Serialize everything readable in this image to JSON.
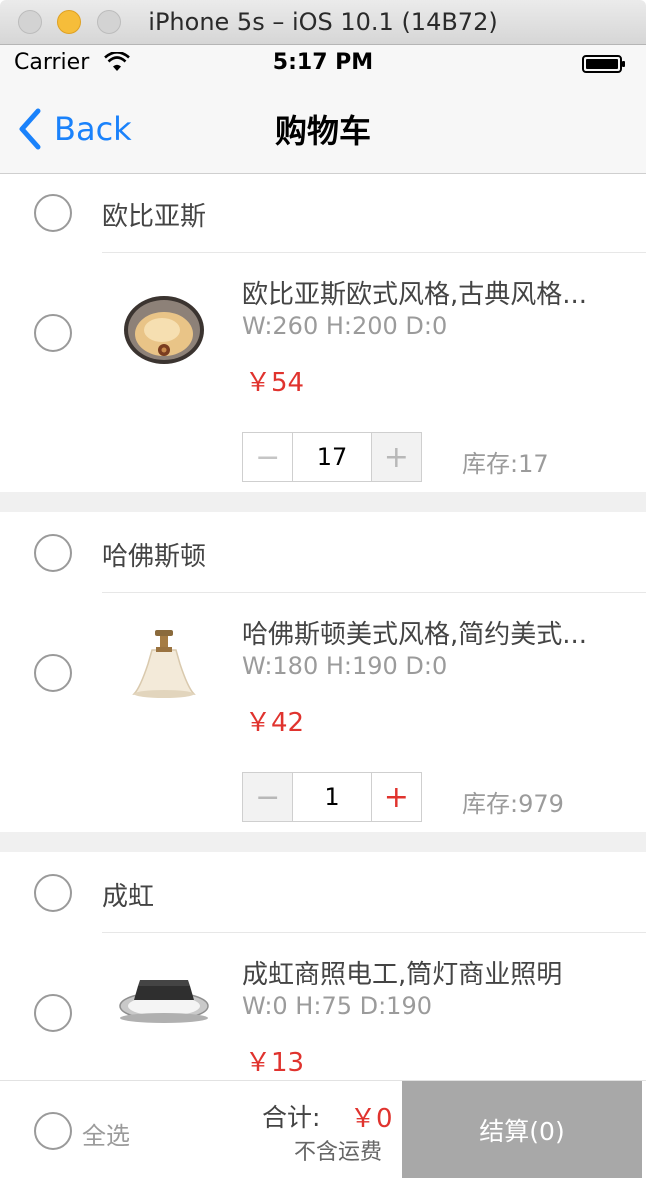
{
  "window": {
    "title": "iPhone 5s – iOS 10.1 (14B72)"
  },
  "status_bar": {
    "carrier": "Carrier",
    "time": "5:17 PM"
  },
  "nav": {
    "back_label": "Back",
    "title": "购物车"
  },
  "shops": [
    {
      "name": "欧比亚斯",
      "item": {
        "title": "欧比亚斯欧式风格,古典风格...",
        "spec": "W:260 H:200 D:0",
        "price": "￥54",
        "quantity": "17",
        "stock": "库存:17",
        "image_icon": "ceiling-lamp-ornate"
      }
    },
    {
      "name": "哈佛斯顿",
      "item": {
        "title": "哈佛斯顿美式风格,简约美式...",
        "spec": "W:180 H:190 D:0",
        "price": "￥42",
        "quantity": "1",
        "stock": "库存:979",
        "image_icon": "pendant-lamp-bell"
      }
    },
    {
      "name": "成虹",
      "item": {
        "title": "成虹商照电工,筒灯商业照明",
        "spec": "W:0 H:75 D:190",
        "price": "￥13",
        "image_icon": "downlight"
      }
    }
  ],
  "footer": {
    "select_all": "全选",
    "total_label": "合计:",
    "total_value": "￥0",
    "shipping_note": "不含运费",
    "checkout_label": "结算(0)"
  },
  "colors": {
    "accent_blue": "#1a82fb",
    "price_red": "#e0332e",
    "checkout_gray": "#a8a8a8"
  }
}
